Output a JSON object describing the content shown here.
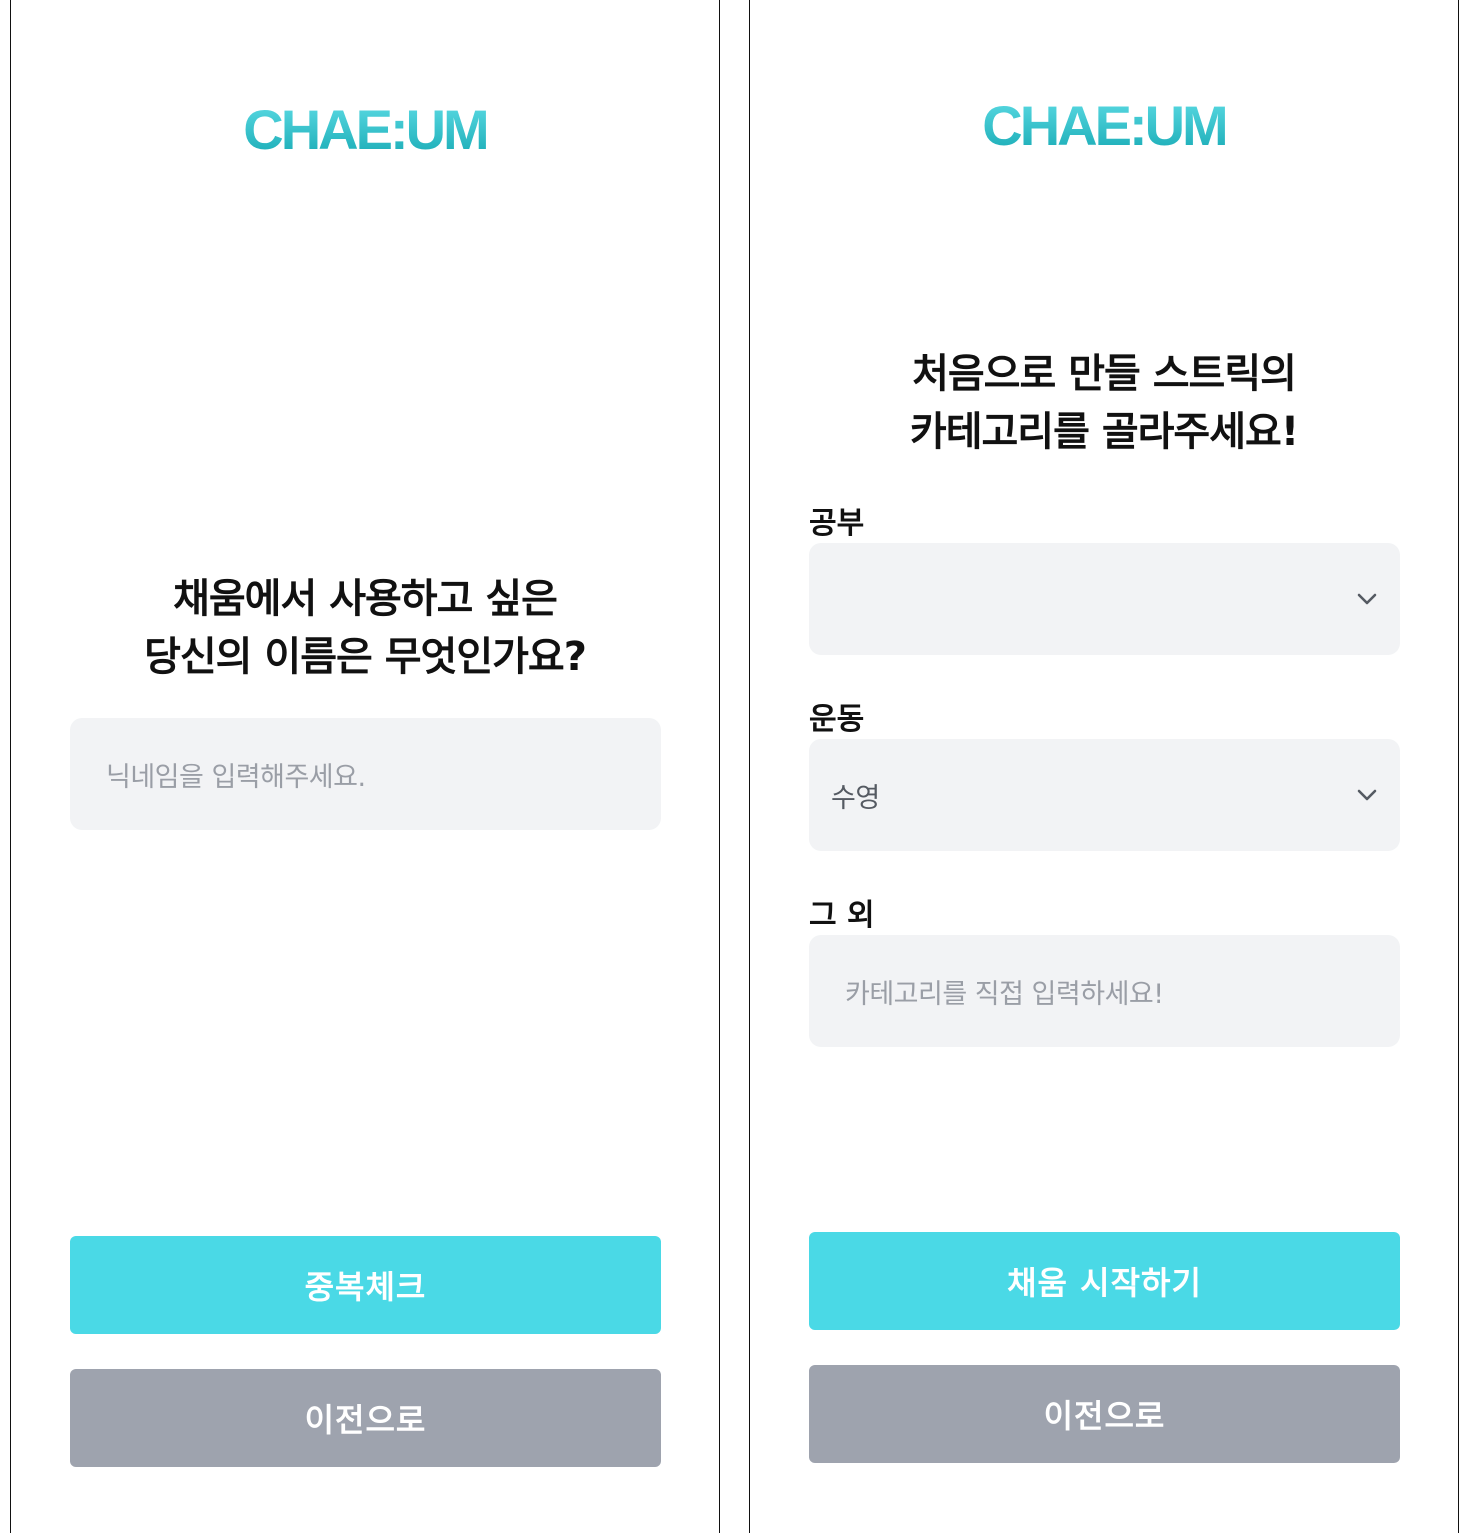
{
  "colors": {
    "brand_teal": "#4ad9e6",
    "logo_gradient_top": "#5fdde6",
    "logo_gradient_bottom": "#16a9b3",
    "secondary_button": "#9ea3ae",
    "field_background": "#f2f3f5",
    "placeholder_text": "#9a9ea6"
  },
  "nickname_screen": {
    "logo_text": "CHAE:UM",
    "heading_line1": "채움에서 사용하고 싶은",
    "heading_line2": "당신의 이름은 무엇인가요?",
    "nickname_input": {
      "value": "",
      "placeholder": "닉네임을 입력해주세요."
    },
    "check_button_label": "중복체크",
    "back_button_label": "이전으로"
  },
  "category_screen": {
    "logo_text": "CHAE:UM",
    "heading_line1": "처음으로 만들 스트릭의",
    "heading_line2": "카테고리를 골라주세요!",
    "study": {
      "label": "공부",
      "selected": "",
      "icon": "chevron-down-icon"
    },
    "exercise": {
      "label": "운동",
      "selected": "수영",
      "icon": "chevron-down-icon"
    },
    "other": {
      "label": "그 외",
      "value": "",
      "placeholder": "카테고리를 직접 입력하세요!"
    },
    "start_button_label": "채움 시작하기",
    "back_button_label": "이전으로"
  }
}
